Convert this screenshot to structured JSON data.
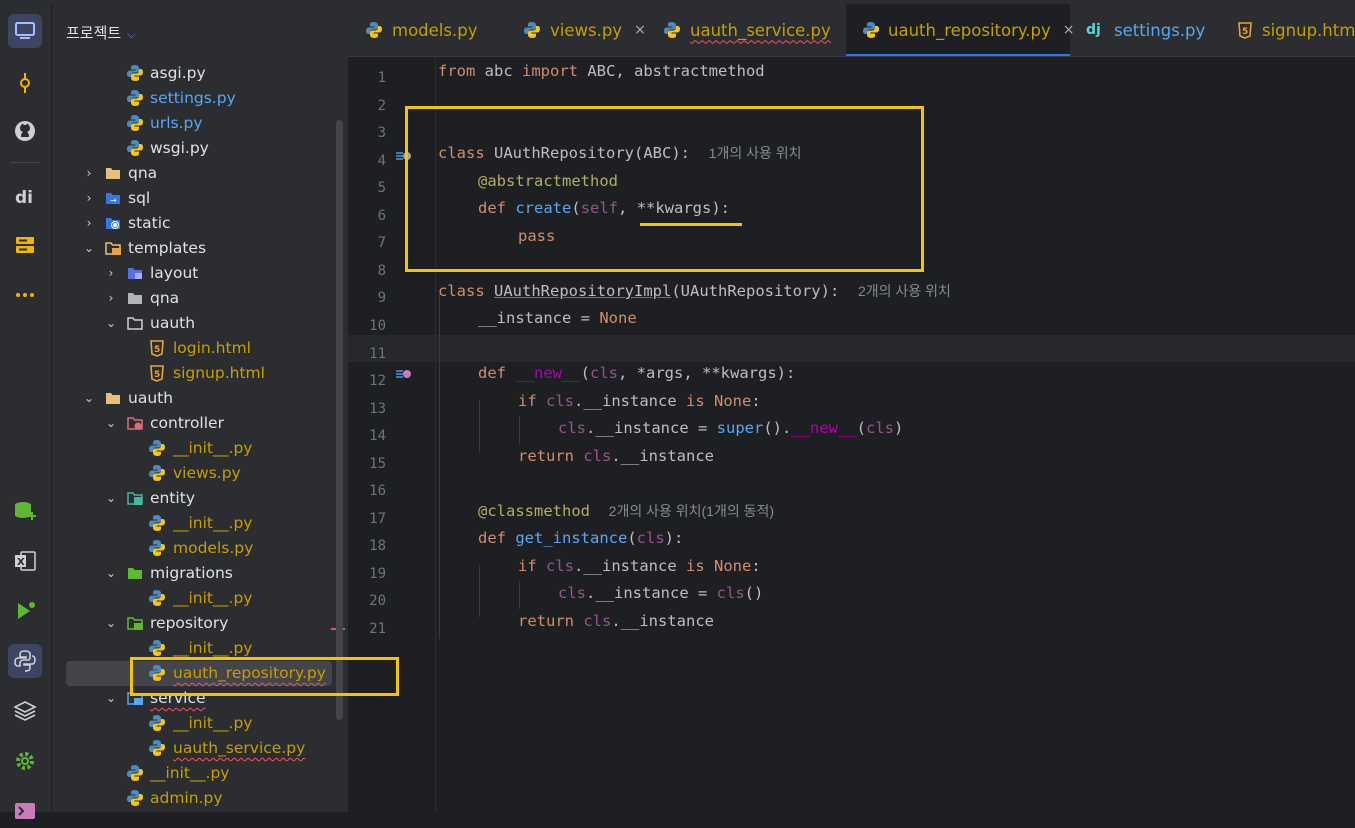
{
  "project_panel": {
    "title": "프로젝트",
    "tree": [
      {
        "label": "asgi.py",
        "type": "py",
        "indent": 3
      },
      {
        "label": "settings.py",
        "type": "py",
        "indent": 3,
        "color": "#56a8f5"
      },
      {
        "label": "urls.py",
        "type": "py",
        "indent": 3,
        "color": "#56a8f5"
      },
      {
        "label": "wsgi.py",
        "type": "py",
        "indent": 3
      },
      {
        "label": "qna",
        "type": "folder",
        "indent": 1,
        "arrow": "›"
      },
      {
        "label": "sql",
        "type": "sql",
        "indent": 1,
        "arrow": "›"
      },
      {
        "label": "static",
        "type": "static",
        "indent": 1,
        "arrow": "›"
      },
      {
        "label": "templates",
        "type": "templates",
        "indent": 1,
        "arrow": "⌄"
      },
      {
        "label": "layout",
        "type": "layout",
        "indent": 2,
        "arrow": "›"
      },
      {
        "label": "qna",
        "type": "greyfolder",
        "indent": 2,
        "arrow": "›"
      },
      {
        "label": "uauth",
        "type": "openfolder",
        "indent": 2,
        "arrow": "⌄"
      },
      {
        "label": "login.html",
        "type": "html",
        "indent": 4,
        "color": "#c4a000"
      },
      {
        "label": "signup.html",
        "type": "html",
        "indent": 4,
        "color": "#c4a000"
      },
      {
        "label": "uauth",
        "type": "folder",
        "indent": 1,
        "arrow": "⌄"
      },
      {
        "label": "controller",
        "type": "controller",
        "indent": 2,
        "arrow": "⌄"
      },
      {
        "label": "__init__.py",
        "type": "py",
        "indent": 4,
        "color": "#c4a000"
      },
      {
        "label": "views.py",
        "type": "py",
        "indent": 4,
        "color": "#c4a000"
      },
      {
        "label": "entity",
        "type": "entity",
        "indent": 2,
        "arrow": "⌄"
      },
      {
        "label": "__init__.py",
        "type": "py",
        "indent": 4,
        "color": "#c4a000"
      },
      {
        "label": "models.py",
        "type": "py",
        "indent": 4,
        "color": "#c4a000"
      },
      {
        "label": "migrations",
        "type": "migrations",
        "indent": 2,
        "arrow": "⌄"
      },
      {
        "label": "__init__.py",
        "type": "py",
        "indent": 4,
        "color": "#c4a000"
      },
      {
        "label": "repository",
        "type": "repository",
        "indent": 2,
        "arrow": "⌄"
      },
      {
        "label": "__init__.py",
        "type": "py",
        "indent": 4,
        "color": "#c4a000"
      },
      {
        "label": "uauth_repository.py",
        "type": "py",
        "indent": 4,
        "color": "#c4a000",
        "selected": true,
        "wavy": true
      },
      {
        "label": "service",
        "type": "service",
        "indent": 2,
        "arrow": "⌄",
        "wavy": true
      },
      {
        "label": "__init__.py",
        "type": "py",
        "indent": 4,
        "color": "#c4a000"
      },
      {
        "label": "uauth_service.py",
        "type": "py",
        "indent": 4,
        "color": "#c4a000",
        "wavy": true
      },
      {
        "label": "__init__.py",
        "type": "py",
        "indent": 3,
        "color": "#c4a000"
      },
      {
        "label": "admin.py",
        "type": "py",
        "indent": 3,
        "color": "#c4a000"
      }
    ]
  },
  "tabs": [
    {
      "label": "models.py",
      "type": "py",
      "color": "#c4a000"
    },
    {
      "label": "views.py",
      "type": "py",
      "color": "#c4a000",
      "close": "×"
    },
    {
      "label": "uauth_service.py",
      "type": "py",
      "color": "#c4a000",
      "wavy": true
    },
    {
      "label": "uauth_repository.py",
      "type": "py",
      "color": "#c4a000",
      "active": true,
      "close": "×"
    },
    {
      "label": "settings.py",
      "type": "dj",
      "color": "#56a8f5"
    },
    {
      "label": "signup.html",
      "type": "html",
      "color": "#c4a000"
    }
  ],
  "line_numbers": [
    "1",
    "2",
    "3",
    "4",
    "5",
    "6",
    "7",
    "8",
    "9",
    "10",
    "11",
    "12",
    "13",
    "14",
    "15",
    "16",
    "17",
    "18",
    "19",
    "20",
    "21"
  ],
  "code": {
    "l1": {
      "kw1": "from",
      "t1": " abc ",
      "kw2": "import",
      "t2": " ABC, abstractmethod"
    },
    "l4": {
      "kw": "class",
      "t1": " ",
      "name": "UAuthRepository",
      "t2": "(ABC):",
      "hint": "1개의 사용 위치"
    },
    "l5": {
      "dec": "@abstractmethod"
    },
    "l6": {
      "kw": "def",
      "t1": " ",
      "fn": "create",
      "t2": "(",
      "self": "self",
      "t3": ", ",
      "kw_arg": "**kwargs",
      "t4": "):"
    },
    "l7": {
      "kw": "pass"
    },
    "l9": {
      "kw": "class",
      "t1": " ",
      "name": "UAuthRepositoryImpl",
      "t2": "(UAuthRepository):",
      "hint": "2개의 사용 위치"
    },
    "l10": {
      "t1": "__instance = ",
      "kw": "None"
    },
    "l12": {
      "kw": "def",
      "t1": " ",
      "fn": "__new__",
      "t2": "(",
      "cls": "cls",
      "t3": ", *args, **kwargs):"
    },
    "l13": {
      "kw1": "if",
      "t1": " ",
      "cls": "cls",
      "t2": ".__instance ",
      "kw2": "is",
      "t3": " ",
      "kw3": "None",
      "t4": ":"
    },
    "l14": {
      "cls": "cls",
      "t1": ".__instance = ",
      "fn": "super",
      "t2": "().",
      "dund": "__new__",
      "t3": "(",
      "cls2": "cls",
      "t4": ")"
    },
    "l15": {
      "kw": "return",
      "t1": " ",
      "cls": "cls",
      "t2": ".__instance"
    },
    "l17": {
      "dec": "@classmethod",
      "hint": "2개의 사용 위치(1개의 동적)"
    },
    "l18": {
      "kw": "def",
      "t1": " ",
      "fn": "get_instance",
      "t2": "(",
      "cls": "cls",
      "t3": "):"
    },
    "l19": {
      "kw1": "if",
      "t1": " ",
      "cls": "cls",
      "t2": ".__instance ",
      "kw2": "is",
      "t3": " ",
      "kw3": "None",
      "t4": ":"
    },
    "l20": {
      "cls": "cls",
      "t1": ".__instance = ",
      "cls2": "cls",
      "t2": "()"
    },
    "l21": {
      "kw": "return",
      "t1": " ",
      "cls": "cls",
      "t2": ".__instance"
    }
  },
  "colors": {
    "highlight": "#f5c400",
    "accent": "#3574f0",
    "keyword": "#cf8e6d",
    "function": "#56a8f5"
  },
  "rail_icons": [
    "monitor-icon",
    "commit-icon",
    "github-icon",
    "dataspell-icon",
    "services-icon",
    "more-icon",
    "database-add-icon",
    "excel-icon",
    "run-icon",
    "python-icon",
    "layers-icon",
    "settings-icon",
    "terminal-icon"
  ]
}
